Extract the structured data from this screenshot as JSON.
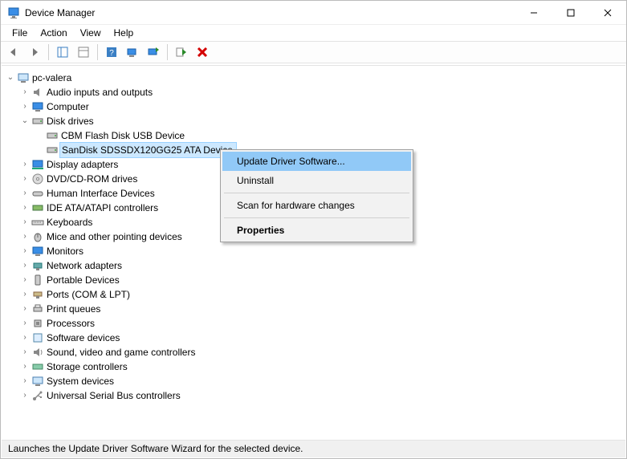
{
  "window": {
    "title": "Device Manager"
  },
  "menu": {
    "file": "File",
    "action": "Action",
    "view": "View",
    "help": "Help"
  },
  "tree": {
    "root": "pc-valera",
    "nodes": {
      "audio": "Audio inputs and outputs",
      "computer": "Computer",
      "disk": "Disk drives",
      "disk_child1": "CBM Flash Disk USB Device",
      "disk_child2": "SanDisk SDSSDX120GG25 ATA Device",
      "display": "Display adapters",
      "dvd": "DVD/CD-ROM drives",
      "hid": "Human Interface Devices",
      "ide": "IDE ATA/ATAPI controllers",
      "keyboards": "Keyboards",
      "mice": "Mice and other pointing devices",
      "monitors": "Monitors",
      "netadapters": "Network adapters",
      "portable": "Portable Devices",
      "ports": "Ports (COM & LPT)",
      "printq": "Print queues",
      "processors": "Processors",
      "software": "Software devices",
      "sound": "Sound, video and game controllers",
      "storage": "Storage controllers",
      "system": "System devices",
      "usb": "Universal Serial Bus controllers"
    }
  },
  "context_menu": {
    "update": "Update Driver Software...",
    "uninstall": "Uninstall",
    "scan": "Scan for hardware changes",
    "properties": "Properties"
  },
  "status": "Launches the Update Driver Software Wizard for the selected device."
}
